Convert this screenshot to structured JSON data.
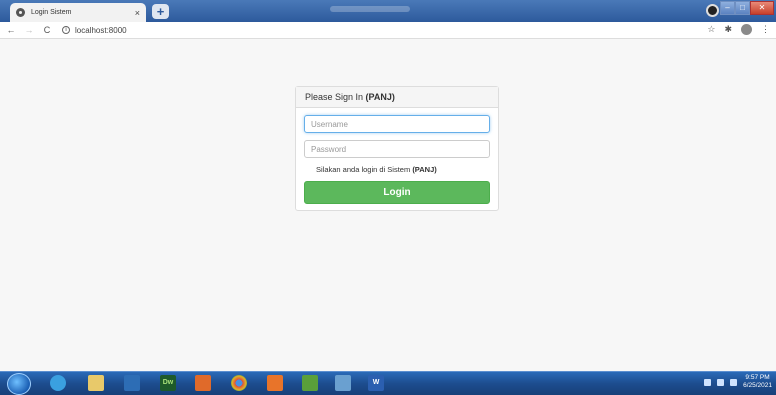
{
  "browser": {
    "tab_title": "Login Sistem",
    "tab_close": "×",
    "new_tab": "+",
    "url": "localhost:8000",
    "back": "←",
    "forward": "→",
    "reload": "C",
    "info": "i",
    "star": "☆",
    "extension": "✱",
    "menu": "⋮"
  },
  "login": {
    "heading_prefix": "Please Sign In ",
    "heading_bold": "(PANJ)",
    "username_placeholder": "Username",
    "password_placeholder": "Password",
    "hint_prefix": "Silakan anda login di Sistem ",
    "hint_bold": "(PANJ)",
    "button_label": "Login"
  },
  "taskbar": {
    "dreamweaver_label": "Dw",
    "word_label": "W",
    "time": "9:57 PM",
    "date": "6/25/2021"
  },
  "colors": {
    "login_button": "#5cb85c",
    "titlebar": "#2d5a9c",
    "focus_border": "#66afe9"
  }
}
